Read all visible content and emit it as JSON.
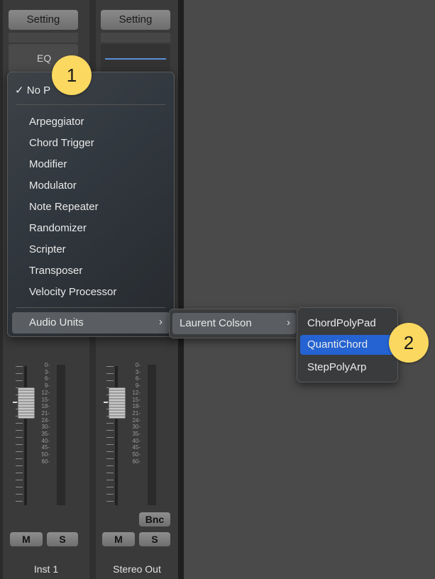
{
  "channels": [
    {
      "setting_label": "Setting",
      "eq_label": "EQ",
      "name": "Inst 1",
      "mute_label": "M",
      "solo_label": "S",
      "scale": [
        "0",
        "3",
        "6",
        "9",
        "12",
        "15",
        "18",
        "21",
        "24",
        "30",
        "35",
        "40",
        "45",
        "50",
        "60"
      ]
    },
    {
      "setting_label": "Setting",
      "name": "Stereo Out",
      "mute_label": "M",
      "solo_label": "S",
      "bounce_label": "Bnc",
      "scale": [
        "0",
        "3",
        "6",
        "9",
        "12",
        "15",
        "18",
        "21",
        "24",
        "30",
        "35",
        "40",
        "45",
        "50",
        "60"
      ]
    }
  ],
  "plugin_menu": {
    "checked_item": "No P",
    "items": [
      "Arpeggiator",
      "Chord Trigger",
      "Modifier",
      "Modulator",
      "Note Repeater",
      "Randomizer",
      "Scripter",
      "Transposer",
      "Velocity Processor"
    ],
    "submenu_item": "Audio Units"
  },
  "au_submenu": {
    "items": [
      "Laurent Colson"
    ]
  },
  "laurent_submenu": {
    "items": [
      "ChordPolyPad",
      "QuantiChord",
      "StepPolyArp"
    ],
    "selected": "QuantiChord"
  },
  "badges": [
    "1",
    "2"
  ],
  "colors": {
    "highlight": "#2463d1",
    "badge": "#fbd85f"
  }
}
